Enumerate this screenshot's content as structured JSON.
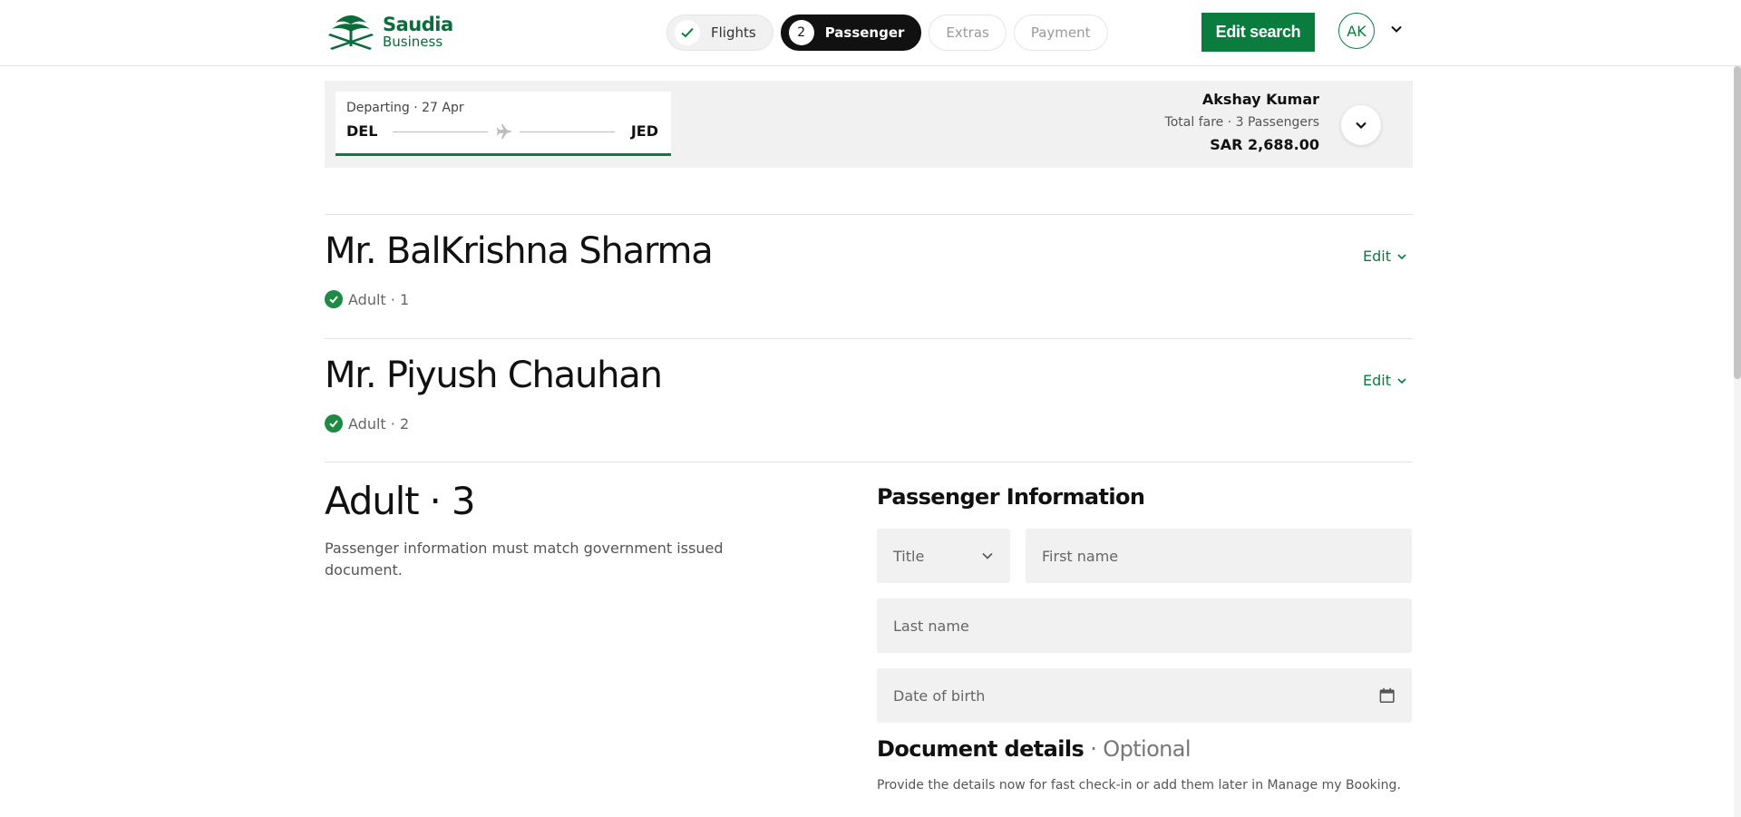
{
  "header": {
    "logo": {
      "brand": "Saudia",
      "sub": "Business"
    },
    "steps": [
      {
        "label": "Flights",
        "state": "done"
      },
      {
        "number": "2",
        "label": "Passenger",
        "state": "active"
      },
      {
        "label": "Extras",
        "state": "pending"
      },
      {
        "label": "Payment",
        "state": "pending"
      }
    ],
    "edit_search": "Edit search",
    "avatar_initials": "AK"
  },
  "summary": {
    "flight": {
      "date": "Departing · 27 Apr",
      "from": "DEL",
      "to": "JED"
    },
    "passenger_name": "Akshay Kumar",
    "fare_label": "Total fare · 3 Passengers",
    "fare_amount": "SAR 2,688.00"
  },
  "passengers": [
    {
      "name": "Mr. BalKrishna Sharma",
      "status": "Adult · 1",
      "edit": "Edit"
    },
    {
      "name": "Mr. Piyush Chauhan",
      "status": "Adult · 2",
      "edit": "Edit"
    }
  ],
  "current": {
    "title": "Adult · 3",
    "description": "Passenger information must match government issued document."
  },
  "form": {
    "title": "Passenger Information",
    "title_placeholder": "Title",
    "first_name_placeholder": "First name",
    "last_name_placeholder": "Last name",
    "dob_placeholder": "Date of birth"
  },
  "documents": {
    "title": "Document details",
    "optional": "· Optional",
    "description": "Provide the details now for fast check-in or add them later in Manage my Booking."
  },
  "colors": {
    "brand_green": "#0a7d3e",
    "active_step": "#111111",
    "panel_bg": "#f1f1f1"
  }
}
